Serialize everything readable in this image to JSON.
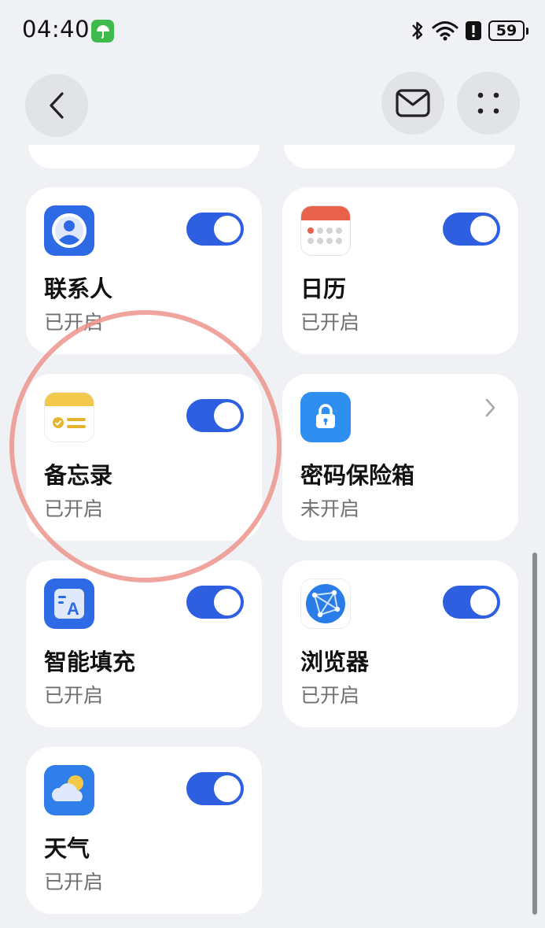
{
  "status_bar": {
    "time": "04:40",
    "battery": "59"
  },
  "header": {
    "back_icon": "chevron-left-icon",
    "mail_icon": "mail-icon",
    "more_icon": "four-dots-icon"
  },
  "cards": [
    {
      "title": "联系人",
      "status": "已开启",
      "icon": "contacts-icon",
      "control": "toggle-on"
    },
    {
      "title": "日历",
      "status": "已开启",
      "icon": "calendar-icon",
      "control": "toggle-on"
    },
    {
      "title": "备忘录",
      "status": "已开启",
      "icon": "notes-icon",
      "control": "toggle-on"
    },
    {
      "title": "密码保险箱",
      "status": "未开启",
      "icon": "password-vault-icon",
      "control": "chevron-right"
    },
    {
      "title": "智能填充",
      "status": "已开启",
      "icon": "autofill-icon",
      "control": "toggle-on"
    },
    {
      "title": "浏览器",
      "status": "已开启",
      "icon": "browser-icon",
      "control": "toggle-on"
    },
    {
      "title": "天气",
      "status": "已开启",
      "icon": "weather-icon",
      "control": "toggle-on"
    }
  ],
  "colors": {
    "accent": "#2d5fe0",
    "background": "#eff1f4",
    "card": "#ffffff",
    "highlight": "#ec948c"
  }
}
